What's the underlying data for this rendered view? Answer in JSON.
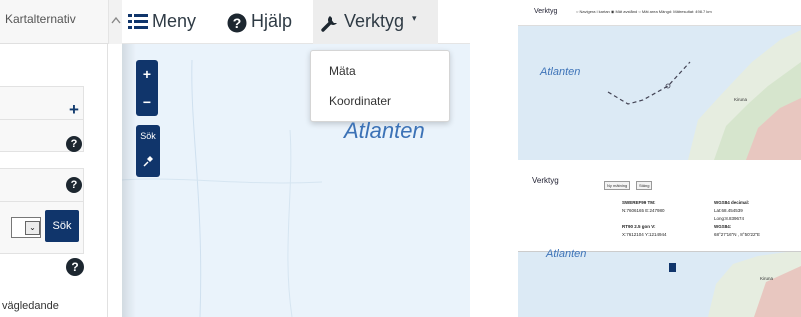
{
  "sidebar": {
    "header_label": "Kartalternativ",
    "search_button": "Sök",
    "footer_text": "vägledande",
    "help_icon_glyph": "?",
    "plus_glyph": "+",
    "select_arrow": "⌄"
  },
  "map_nav": {
    "menu_label": "Meny",
    "help_label": "Hjälp",
    "tools_label": "Verktyg",
    "tools_caret": "▾",
    "dropdown": [
      "Mäta",
      "Koordinater"
    ],
    "zoom_in": "+",
    "zoom_out": "−",
    "search_label": "Sök",
    "map_label": "Atlanten"
  },
  "right_top": {
    "tools_label": "Verktyg",
    "options_text": "○ Navigera i kartan ◉ Mät avstånd ○ Mät area   Mängd:   Mätresultat: 498.7 km",
    "map_label": "Atlanten",
    "city_label": "Kiruna"
  },
  "right_bottom": {
    "tools_label": "Verktyg",
    "new_measure_btn": "Ny mätning",
    "close_btn": "Stäng",
    "sweref_title": "SWEREF99 TM:",
    "sweref_values": "N:7606165 E:247980",
    "rt90_title": "RT90 2.5 gon V:",
    "rt90_values": "X:7612104 Y:1214944",
    "wgs_decimal_title": "WGS84 decimal:",
    "wgs_lat": "Lat:68.454539",
    "wgs_long": "Long:8.839674",
    "wgs_title": "WGS84:",
    "wgs_dms": "68°27'16\"N , 8°50'22\"E",
    "map_label": "Atlanten",
    "city_label": "Kiruna"
  },
  "colors": {
    "primary_button": "#10356b",
    "map_water": "#eaf3fb",
    "map_label": "#3c72b6",
    "land": "#e6ede0"
  }
}
